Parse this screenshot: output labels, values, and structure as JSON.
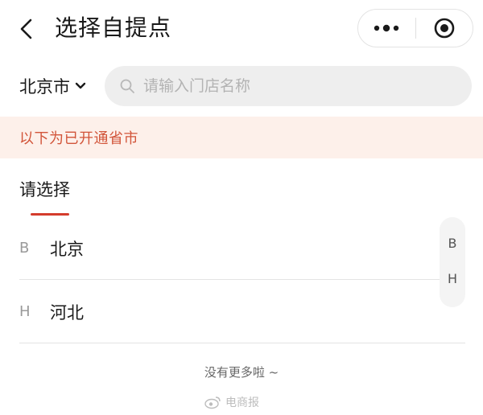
{
  "header": {
    "title": "选择自提点",
    "back_icon": "chevron-left-icon",
    "more_icon": "more-dots-icon",
    "close_icon": "target-circle-icon"
  },
  "location": {
    "city": "北京市",
    "dropdown_icon": "chevron-down-icon"
  },
  "search": {
    "placeholder": "请输入门店名称",
    "value": ""
  },
  "notice": {
    "text": "以下为已开通省市"
  },
  "tabs": [
    {
      "label": "请选择",
      "active": true
    }
  ],
  "provinces": [
    {
      "letter": "B",
      "name": "北京"
    },
    {
      "letter": "H",
      "name": "河北"
    }
  ],
  "index_bar": [
    "B",
    "H"
  ],
  "footer": {
    "no_more_text": "没有更多啦 ~",
    "watermark_text": "电商报"
  },
  "colors": {
    "accent": "#d43c2c",
    "notice_bg": "#fdf0ea",
    "notice_text": "#d2553a"
  }
}
